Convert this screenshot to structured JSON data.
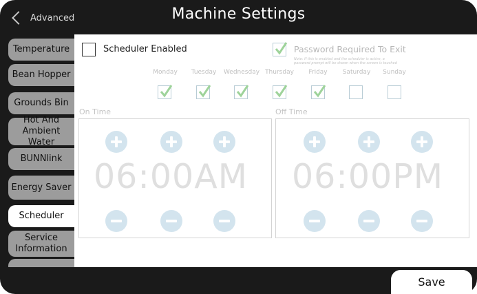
{
  "header": {
    "back_label": "Advanced",
    "title": "Machine Settings"
  },
  "sidebar": {
    "items": [
      {
        "label": "Temperature"
      },
      {
        "label": "Bean Hopper"
      },
      {
        "label": "Grounds Bin"
      },
      {
        "label": "Hot And Ambient Water"
      },
      {
        "label": "BUNNlink"
      },
      {
        "label": "Energy Saver"
      },
      {
        "label": "Scheduler",
        "active": true
      },
      {
        "label": "Service Information"
      }
    ]
  },
  "scheduler": {
    "enabled_label": "Scheduler Enabled",
    "enabled": false,
    "password_label": "Password Required To Exit",
    "password_required": true,
    "password_note": "Note: If this is enabled and the scheduler is active, a password prompt will be shown when the screen is touched",
    "days": [
      {
        "label": "Monday",
        "checked": true
      },
      {
        "label": "Tuesday",
        "checked": true
      },
      {
        "label": "Wednesday",
        "checked": true
      },
      {
        "label": "Thursday",
        "checked": true
      },
      {
        "label": "Friday",
        "checked": true
      },
      {
        "label": "Saturday",
        "checked": false
      },
      {
        "label": "Sunday",
        "checked": false
      }
    ],
    "on_time": {
      "label": "On Time",
      "value": "06:00AM"
    },
    "off_time": {
      "label": "Off Time",
      "value": "06:00PM"
    }
  },
  "footer": {
    "save_label": "Save"
  },
  "colors": {
    "bar": "#1a1a1a",
    "tab": "#9c9c9c",
    "check": "#9ed39a",
    "stepper": "#d3e4ee"
  }
}
